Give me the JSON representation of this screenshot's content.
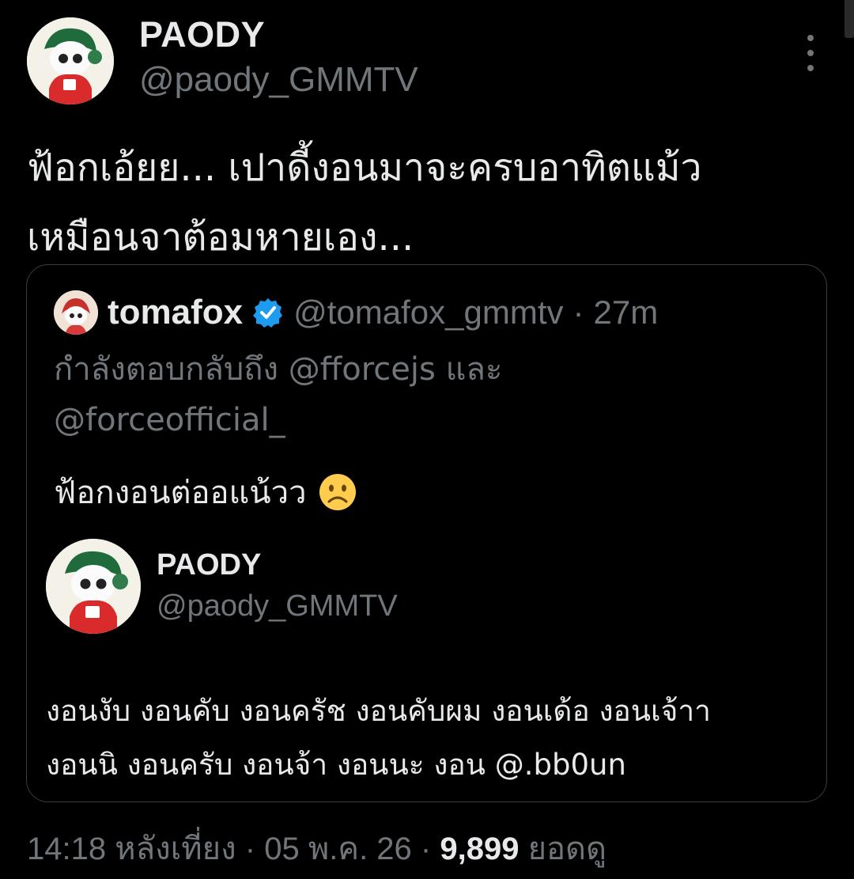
{
  "tweet": {
    "author_name": "PAODY",
    "author_handle": "@paody_GMMTV",
    "text_lines": [
      "ฟ้อกเอ้ยย... เปาดี้งอนมาจะครบอาทิตแม้ว",
      "เหมือนจาต้อมหายเอง..."
    ],
    "more_icon": "more-vertical-icon"
  },
  "quote": {
    "author_name": "tomafox",
    "verified_icon": "verified-badge-icon",
    "author_handle": "@tomafox_gmmtv",
    "separator": "·",
    "time": "27m",
    "reply_prefix": "กำลังตอบกลับถึง",
    "reply_mention_1": "@fforcejs",
    "reply_joiner": "และ",
    "reply_mention_2": "@forceofficial_",
    "text": "ฟ้อกงอนต่ออแน้วว",
    "emoji_icon": "frowning-face-icon",
    "nested": {
      "author_name": "PAODY",
      "author_handle": "@paody_GMMTV",
      "text_lines": [
        "งอนงับ งอนคับ งอนครัช งอนคับผม งอนเด้อ งอนเจ้าา",
        "งอนนิ งอนครับ งอนจ้า งอนนะ งอน @.bb0un"
      ]
    }
  },
  "meta": {
    "time": "14:18 หลังเที่ยง",
    "separator": "·",
    "date": "05 พ.ค. 26",
    "separator_2": "·",
    "views": "9,899",
    "views_label": "ยอดดู"
  },
  "colors": {
    "background": "#000000",
    "text_primary": "#e7e9ea",
    "text_secondary": "#71767b",
    "border": "#3a3d40",
    "verified": "#1d9bf0"
  }
}
